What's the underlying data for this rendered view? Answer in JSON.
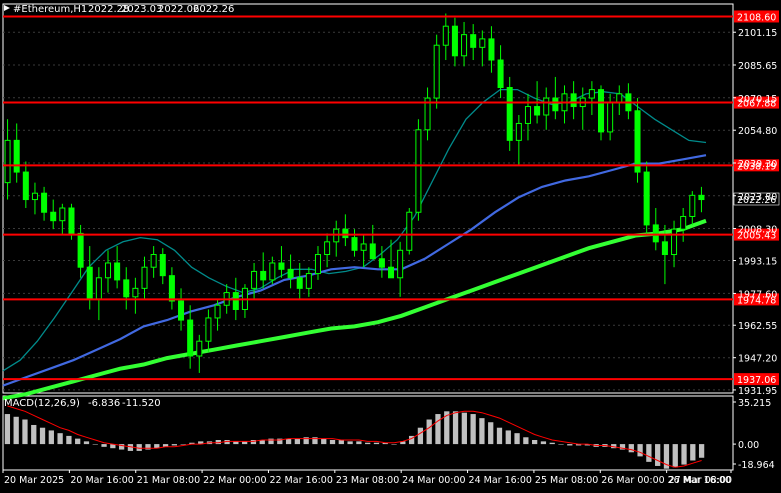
{
  "header": {
    "symbol_label": "#Ethereum,H1",
    "ohlc": [
      "2022.28",
      "2023.03",
      "2022.06",
      "2022.26"
    ]
  },
  "macd": {
    "label": "MACD(12,26,9)",
    "main_value": "-6.836",
    "signal_value": "-11.520",
    "ticks": [
      "35.215",
      "0.00",
      "-18.964"
    ]
  },
  "colors": {
    "background": "#000000",
    "grid": "#3a3a3a",
    "axis_text": "#ffffff",
    "candles": "#00ff00",
    "level_line": "#ff0000",
    "ma_slow": "#33ff33",
    "ma_mid": "#4169e1",
    "ma_fast": "#008b8b",
    "macd_hist": "#c0c0c0",
    "macd_signal": "#ff0000",
    "current_price_bg": "#000000"
  },
  "chart_data": [
    {
      "type": "candlestick",
      "title": "#Ethereum,H1",
      "ylim": [
        1930.5,
        2114.5
      ],
      "x_ticks": [
        "20 Mar 2025",
        "20 Mar 16:00",
        "21 Mar 08:00",
        "22 Mar 00:00",
        "22 Mar 16:00",
        "23 Mar 08:00",
        "24 Mar 00:00",
        "24 Mar 16:00",
        "25 Mar 08:00",
        "26 Mar 00:00",
        "26 Mar 16:00",
        "27 Mar 08:00"
      ],
      "y_ticks": [
        "2101.15",
        "2085.65",
        "2070.15",
        "2054.80",
        "2039.30",
        "2023.80",
        "2008.30",
        "1993.15",
        "1977.60",
        "1962.55",
        "1947.20",
        "1931.95"
      ],
      "y_tick_values": [
        2101.15,
        2085.65,
        2070.15,
        2054.8,
        2039.3,
        2023.8,
        2008.3,
        1993.15,
        1977.6,
        1962.55,
        1947.2,
        1931.95
      ],
      "level_lines": [
        {
          "label": "2108.60",
          "value": 2108.6
        },
        {
          "label": "2067.88",
          "value": 2067.88
        },
        {
          "label": "2038.19",
          "value": 2038.19
        },
        {
          "label": "2005.43",
          "value": 2005.43
        },
        {
          "label": "1974.78",
          "value": 1974.78
        },
        {
          "label": "1937.06",
          "value": 1937.06
        }
      ],
      "current_price": {
        "label": "2022.26",
        "value": 2022.26
      },
      "candles": [
        {
          "o": 2030,
          "h": 2060,
          "l": 2022,
          "c": 2050
        },
        {
          "o": 2050,
          "h": 2058,
          "l": 2030,
          "c": 2035
        },
        {
          "o": 2035,
          "h": 2040,
          "l": 2018,
          "c": 2022
        },
        {
          "o": 2022,
          "h": 2030,
          "l": 2015,
          "c": 2025
        },
        {
          "o": 2025,
          "h": 2028,
          "l": 2012,
          "c": 2016
        },
        {
          "o": 2016,
          "h": 2022,
          "l": 2008,
          "c": 2012
        },
        {
          "o": 2012,
          "h": 2020,
          "l": 2005,
          "c": 2018
        },
        {
          "o": 2018,
          "h": 2020,
          "l": 2003,
          "c": 2006
        },
        {
          "o": 2006,
          "h": 2010,
          "l": 1985,
          "c": 1990
        },
        {
          "o": 1990,
          "h": 2000,
          "l": 1970,
          "c": 1975
        },
        {
          "o": 1975,
          "h": 1990,
          "l": 1965,
          "c": 1985
        },
        {
          "o": 1985,
          "h": 1998,
          "l": 1978,
          "c": 1992
        },
        {
          "o": 1992,
          "h": 2000,
          "l": 1980,
          "c": 1984
        },
        {
          "o": 1984,
          "h": 1990,
          "l": 1970,
          "c": 1976
        },
        {
          "o": 1976,
          "h": 1985,
          "l": 1968,
          "c": 1980
        },
        {
          "o": 1980,
          "h": 1995,
          "l": 1975,
          "c": 1990
        },
        {
          "o": 1990,
          "h": 2000,
          "l": 1985,
          "c": 1996
        },
        {
          "o": 1996,
          "h": 1999,
          "l": 1982,
          "c": 1986
        },
        {
          "o": 1986,
          "h": 1990,
          "l": 1970,
          "c": 1974
        },
        {
          "o": 1974,
          "h": 1980,
          "l": 1960,
          "c": 1965
        },
        {
          "o": 1965,
          "h": 1972,
          "l": 1942,
          "c": 1948
        },
        {
          "o": 1948,
          "h": 1958,
          "l": 1940,
          "c": 1955
        },
        {
          "o": 1955,
          "h": 1970,
          "l": 1950,
          "c": 1966
        },
        {
          "o": 1966,
          "h": 1975,
          "l": 1960,
          "c": 1972
        },
        {
          "o": 1972,
          "h": 1982,
          "l": 1968,
          "c": 1978
        },
        {
          "o": 1978,
          "h": 1985,
          "l": 1965,
          "c": 1970
        },
        {
          "o": 1970,
          "h": 1982,
          "l": 1966,
          "c": 1980
        },
        {
          "o": 1980,
          "h": 1992,
          "l": 1975,
          "c": 1988
        },
        {
          "o": 1988,
          "h": 1997,
          "l": 1980,
          "c": 1984
        },
        {
          "o": 1984,
          "h": 1995,
          "l": 1982,
          "c": 1992
        },
        {
          "o": 1992,
          "h": 2000,
          "l": 1985,
          "c": 1989
        },
        {
          "o": 1989,
          "h": 1996,
          "l": 1980,
          "c": 1985
        },
        {
          "o": 1985,
          "h": 1992,
          "l": 1975,
          "c": 1980
        },
        {
          "o": 1980,
          "h": 1990,
          "l": 1976,
          "c": 1987
        },
        {
          "o": 1987,
          "h": 2000,
          "l": 1984,
          "c": 1996
        },
        {
          "o": 1996,
          "h": 2006,
          "l": 1990,
          "c": 2002
        },
        {
          "o": 2002,
          "h": 2012,
          "l": 1995,
          "c": 2008
        },
        {
          "o": 2008,
          "h": 2015,
          "l": 2000,
          "c": 2004
        },
        {
          "o": 2004,
          "h": 2008,
          "l": 1995,
          "c": 1998
        },
        {
          "o": 1998,
          "h": 2005,
          "l": 1990,
          "c": 2001
        },
        {
          "o": 2001,
          "h": 2010,
          "l": 1996,
          "c": 1994
        },
        {
          "o": 1994,
          "h": 2000,
          "l": 1985,
          "c": 1990
        },
        {
          "o": 1990,
          "h": 2003,
          "l": 1985,
          "c": 1985
        },
        {
          "o": 1985,
          "h": 2002,
          "l": 1976,
          "c": 1998
        },
        {
          "o": 1998,
          "h": 2018,
          "l": 1996,
          "c": 2016
        },
        {
          "o": 2016,
          "h": 2060,
          "l": 2012,
          "c": 2055
        },
        {
          "o": 2055,
          "h": 2075,
          "l": 2050,
          "c": 2070
        },
        {
          "o": 2070,
          "h": 2100,
          "l": 2065,
          "c": 2095
        },
        {
          "o": 2095,
          "h": 2110,
          "l": 2088,
          "c": 2104
        },
        {
          "o": 2104,
          "h": 2108,
          "l": 2085,
          "c": 2090
        },
        {
          "o": 2090,
          "h": 2106,
          "l": 2085,
          "c": 2100
        },
        {
          "o": 2100,
          "h": 2105,
          "l": 2088,
          "c": 2094
        },
        {
          "o": 2094,
          "h": 2102,
          "l": 2085,
          "c": 2098
        },
        {
          "o": 2098,
          "h": 2104,
          "l": 2082,
          "c": 2088
        },
        {
          "o": 2088,
          "h": 2095,
          "l": 2070,
          "c": 2075
        },
        {
          "o": 2075,
          "h": 2080,
          "l": 2045,
          "c": 2050
        },
        {
          "o": 2050,
          "h": 2062,
          "l": 2038,
          "c": 2058
        },
        {
          "o": 2058,
          "h": 2072,
          "l": 2050,
          "c": 2066
        },
        {
          "o": 2066,
          "h": 2078,
          "l": 2058,
          "c": 2062
        },
        {
          "o": 2062,
          "h": 2075,
          "l": 2055,
          "c": 2070
        },
        {
          "o": 2070,
          "h": 2080,
          "l": 2060,
          "c": 2064
        },
        {
          "o": 2064,
          "h": 2076,
          "l": 2058,
          "c": 2072
        },
        {
          "o": 2072,
          "h": 2078,
          "l": 2060,
          "c": 2066
        },
        {
          "o": 2066,
          "h": 2075,
          "l": 2055,
          "c": 2070
        },
        {
          "o": 2070,
          "h": 2078,
          "l": 2062,
          "c": 2074
        },
        {
          "o": 2074,
          "h": 2076,
          "l": 2050,
          "c": 2054
        },
        {
          "o": 2054,
          "h": 2072,
          "l": 2050,
          "c": 2068
        },
        {
          "o": 2068,
          "h": 2076,
          "l": 2062,
          "c": 2072
        },
        {
          "o": 2072,
          "h": 2077,
          "l": 2060,
          "c": 2064
        },
        {
          "o": 2064,
          "h": 2070,
          "l": 2030,
          "c": 2035
        },
        {
          "o": 2035,
          "h": 2040,
          "l": 2005,
          "c": 2010
        },
        {
          "o": 2010,
          "h": 2018,
          "l": 1998,
          "c": 2002
        },
        {
          "o": 2002,
          "h": 2010,
          "l": 1982,
          "c": 1996
        },
        {
          "o": 1996,
          "h": 2012,
          "l": 1990,
          "c": 2008
        },
        {
          "o": 2008,
          "h": 2018,
          "l": 2002,
          "c": 2014
        },
        {
          "o": 2014,
          "h": 2026,
          "l": 2010,
          "c": 2024
        },
        {
          "o": 2024,
          "h": 2028,
          "l": 2016,
          "c": 2022
        }
      ],
      "series": [
        {
          "values": [
            1941,
            1946,
            1955,
            1966,
            1978,
            1990,
            1998,
            2002,
            2004,
            2003,
            1998,
            1990,
            1985,
            1981,
            1978,
            1980,
            1985,
            1989,
            1989,
            1987,
            1988,
            1990,
            1996,
            2003,
            2014,
            2030,
            2046,
            2060,
            2068,
            2074,
            2074,
            2070,
            2067,
            2068,
            2072,
            2073,
            2072,
            2066,
            2060,
            2055,
            2050,
            2049
          ]
        },
        {
          "values": [
            1934,
            1938,
            1942,
            1946,
            1951,
            1956,
            1962,
            1965,
            1969,
            1972,
            1976,
            1979,
            1984,
            1986,
            1989,
            1990,
            1989,
            1989,
            1994,
            2001,
            2008,
            2016,
            2023,
            2028,
            2031,
            2033,
            2036,
            2039,
            2039,
            2041,
            2043
          ]
        },
        {
          "values": [
            1928,
            1930,
            1933,
            1936,
            1939,
            1942,
            1944,
            1947,
            1949,
            1951,
            1953,
            1955,
            1957,
            1959,
            1961,
            1962,
            1964,
            1967,
            1971,
            1975,
            1979,
            1983,
            1987,
            1991,
            1995,
            1999,
            2002,
            2005,
            2006,
            2008,
            2012
          ]
        }
      ]
    },
    {
      "type": "bar",
      "title": "MACD(12,26,9)",
      "ylim": [
        -18.964,
        35.215
      ],
      "histogram": [
        22,
        20,
        18,
        14,
        12,
        10,
        8,
        6,
        4,
        2,
        0,
        -2,
        -3,
        -4,
        -5,
        -5,
        -4,
        -3,
        -2,
        -1,
        0,
        1,
        2,
        2,
        3,
        3,
        2,
        2,
        3,
        3,
        4,
        4,
        4,
        4,
        5,
        5,
        4,
        3,
        3,
        2,
        2,
        1,
        1,
        1,
        0,
        2,
        6,
        12,
        18,
        22,
        24,
        24,
        23,
        22,
        19,
        16,
        12,
        10,
        8,
        5,
        3,
        2,
        1,
        0,
        -1,
        -1,
        -1,
        -2,
        -2,
        -3,
        -4,
        -6,
        -9,
        -13,
        -16,
        -18,
        -17,
        -15,
        -12,
        -10
      ],
      "signal": [
        28,
        26,
        24,
        21,
        18,
        15,
        12,
        10,
        7,
        5,
        3,
        1,
        0,
        -1,
        -2,
        -3,
        -3,
        -3,
        -2,
        -2,
        -1,
        0,
        0,
        1,
        1,
        2,
        2,
        2,
        2,
        3,
        3,
        3,
        4,
        4,
        4,
        4,
        4,
        4,
        3,
        3,
        3,
        2,
        2,
        1,
        1,
        2,
        4,
        8,
        12,
        17,
        21,
        23,
        24,
        24,
        23,
        21,
        19,
        16,
        13,
        10,
        7,
        5,
        3,
        2,
        1,
        0,
        0,
        -1,
        -1,
        -2,
        -3,
        -4,
        -6,
        -9,
        -12,
        -15,
        -17,
        -16,
        -14,
        -12
      ]
    }
  ]
}
